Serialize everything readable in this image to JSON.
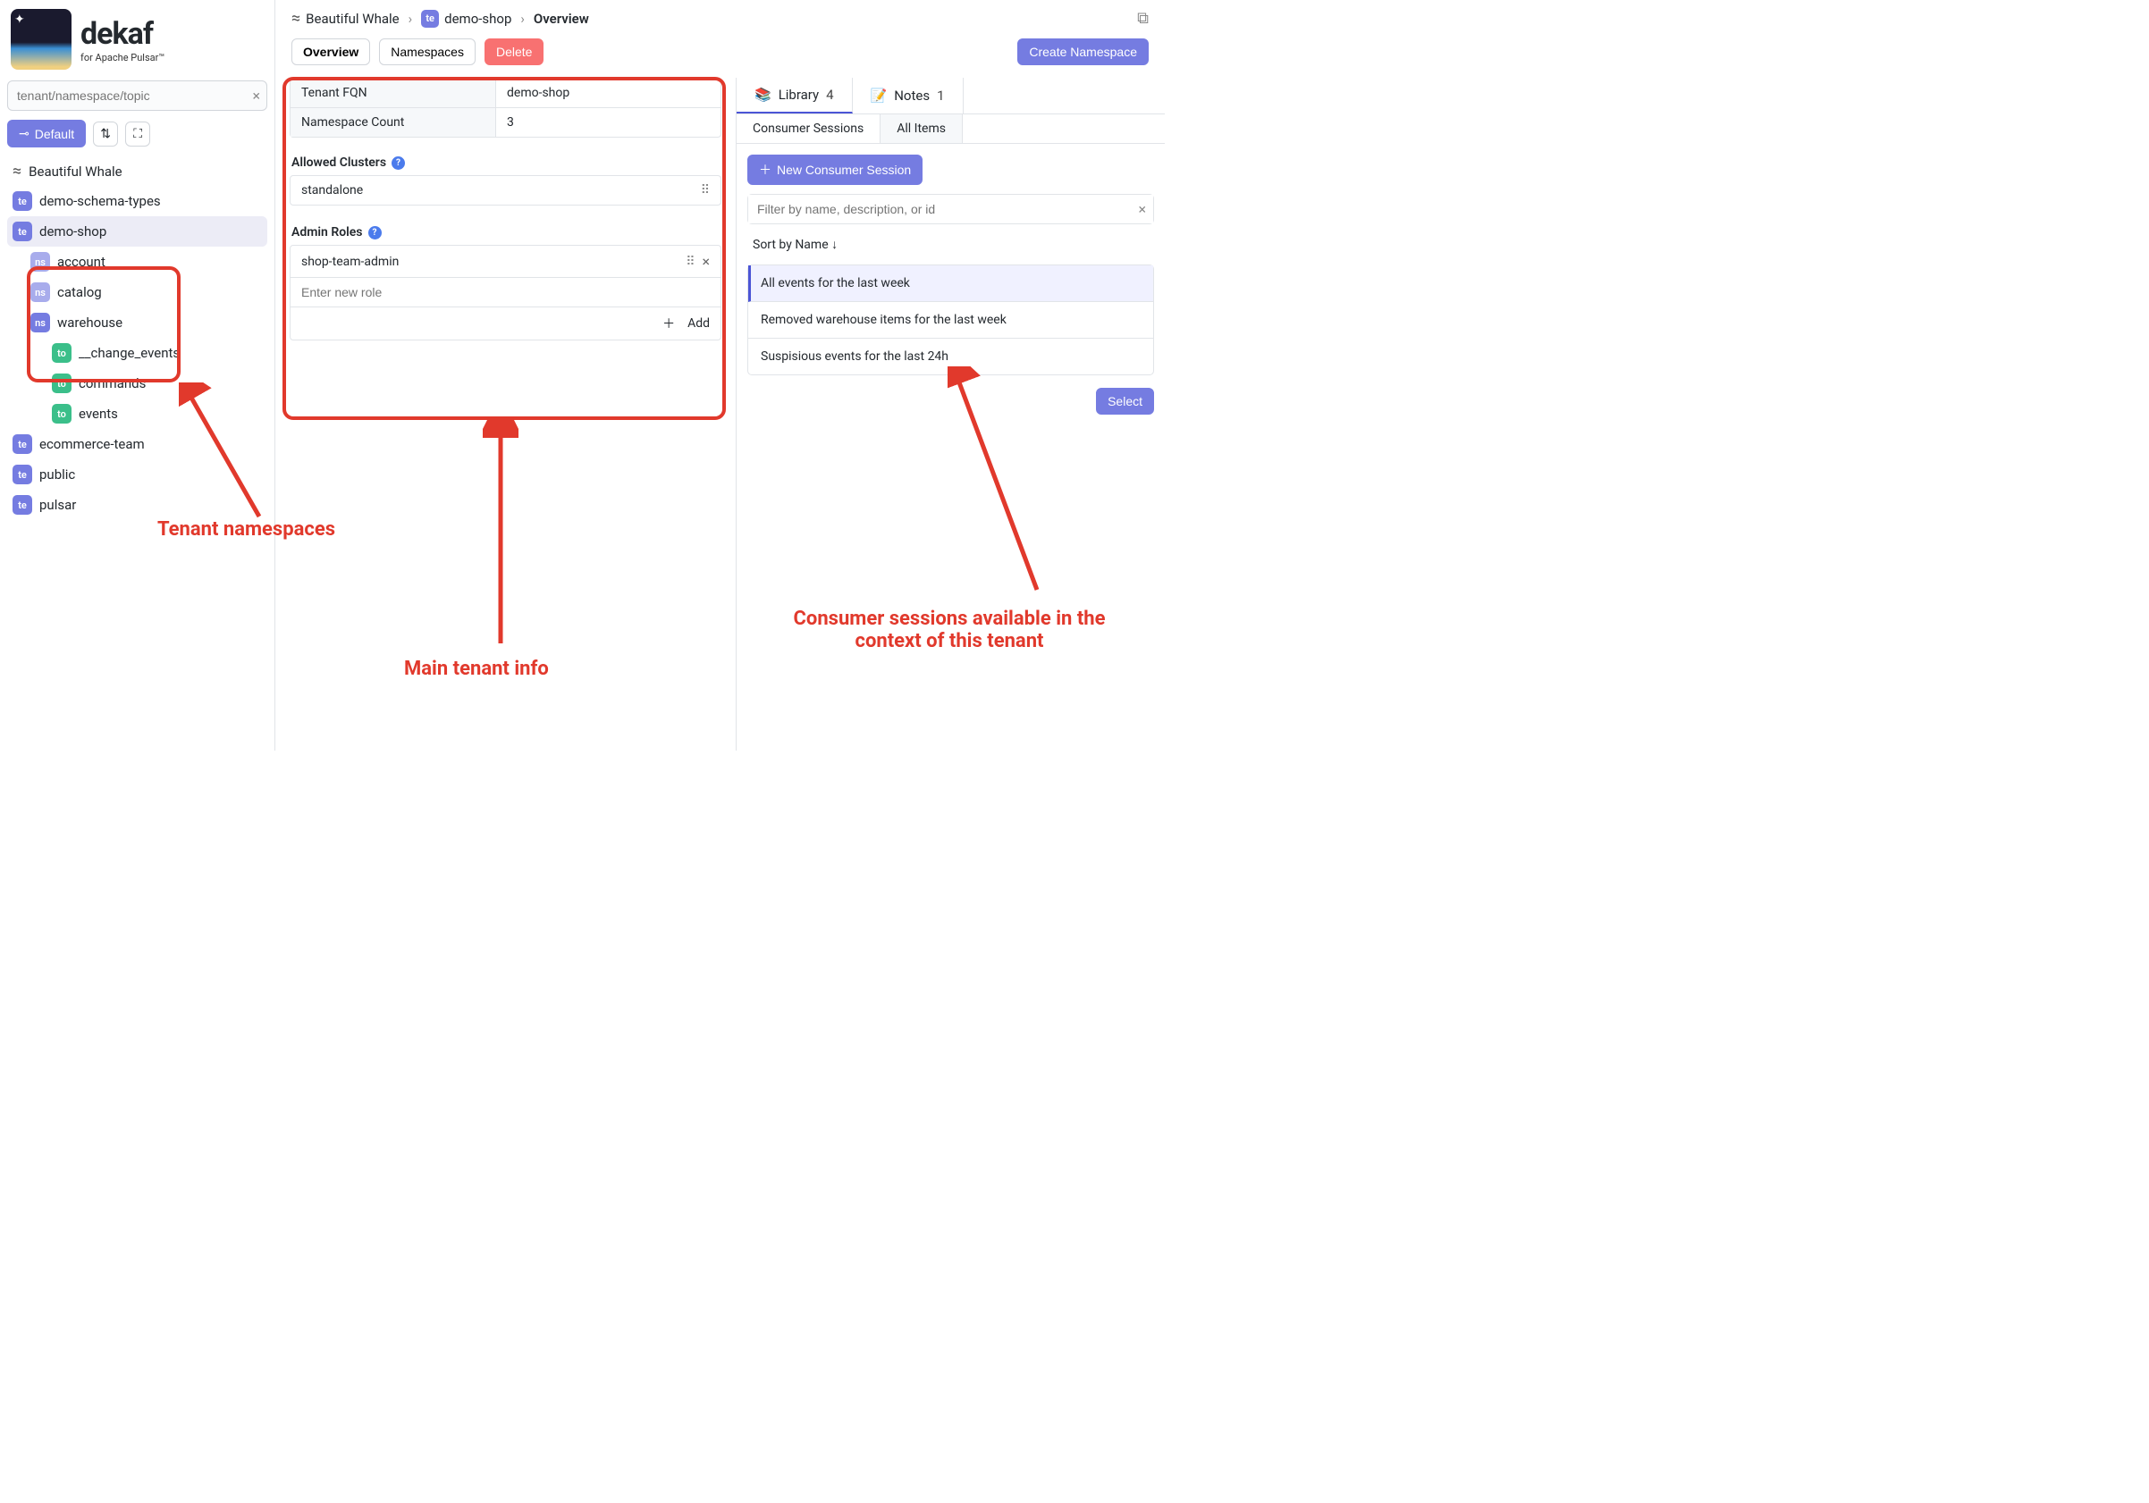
{
  "brand": {
    "name": "dekaf",
    "tagline": "for Apache Pulsar™"
  },
  "search": {
    "placeholder": "tenant/namespace/topic"
  },
  "controls": {
    "default_btn": "Default"
  },
  "tree": {
    "cluster": "Beautiful Whale",
    "tenants": [
      {
        "name": "demo-schema-types"
      },
      {
        "name": "demo-shop",
        "selected": true,
        "namespaces": [
          {
            "name": "account"
          },
          {
            "name": "catalog"
          },
          {
            "name": "warehouse",
            "topics": [
              {
                "name": "__change_events"
              },
              {
                "name": "commands"
              },
              {
                "name": "events"
              }
            ]
          }
        ]
      },
      {
        "name": "ecommerce-team"
      },
      {
        "name": "public"
      },
      {
        "name": "pulsar"
      }
    ]
  },
  "breadcrumb": {
    "cluster": "Beautiful Whale",
    "tenant": "demo-shop",
    "page": "Overview"
  },
  "toolbar": {
    "overview": "Overview",
    "namespaces": "Namespaces",
    "delete": "Delete",
    "create_namespace": "Create Namespace"
  },
  "tenant_info": {
    "fqn_label": "Tenant FQN",
    "fqn_value": "demo-shop",
    "ns_count_label": "Namespace Count",
    "ns_count_value": "3"
  },
  "allowed_clusters": {
    "title": "Allowed Clusters",
    "items": [
      "standalone"
    ]
  },
  "admin_roles": {
    "title": "Admin Roles",
    "items": [
      "shop-team-admin"
    ],
    "new_placeholder": "Enter new role",
    "add_label": "Add"
  },
  "right": {
    "library_tab": "Library",
    "library_count": "4",
    "notes_tab": "Notes",
    "notes_count": "1",
    "sub_consumer": "Consumer Sessions",
    "sub_all": "All Items",
    "new_session": "New Consumer Session",
    "filter_placeholder": "Filter by name, description, or id",
    "sort_label": "Sort by Name ↓",
    "sessions": [
      "All events for the last week",
      "Removed warehouse items for the last week",
      "Suspisious events for the last 24h"
    ],
    "select_btn": "Select"
  },
  "annotations": {
    "namespaces": "Tenant namespaces",
    "main_info": "Main tenant info",
    "sessions": "Consumer sessions available in the context of  this tenant"
  }
}
